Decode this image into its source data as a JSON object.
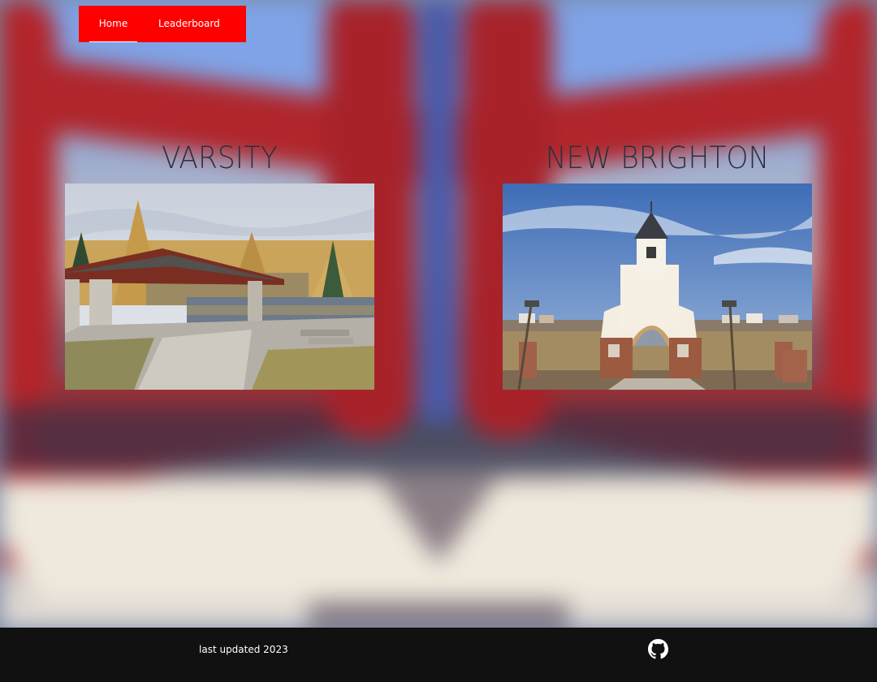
{
  "nav": {
    "items": [
      {
        "label": "Home",
        "active": true
      },
      {
        "label": "Leaderboard",
        "active": false
      }
    ],
    "background_color": "#ff0000"
  },
  "communities": [
    {
      "name": "VARSITY",
      "image": "park-pavilion-by-pond"
    },
    {
      "name": "NEW BRIGHTON",
      "image": "white-bell-tower-gateway"
    }
  ],
  "footer": {
    "text": "last updated 2023",
    "icon": "github-icon"
  }
}
